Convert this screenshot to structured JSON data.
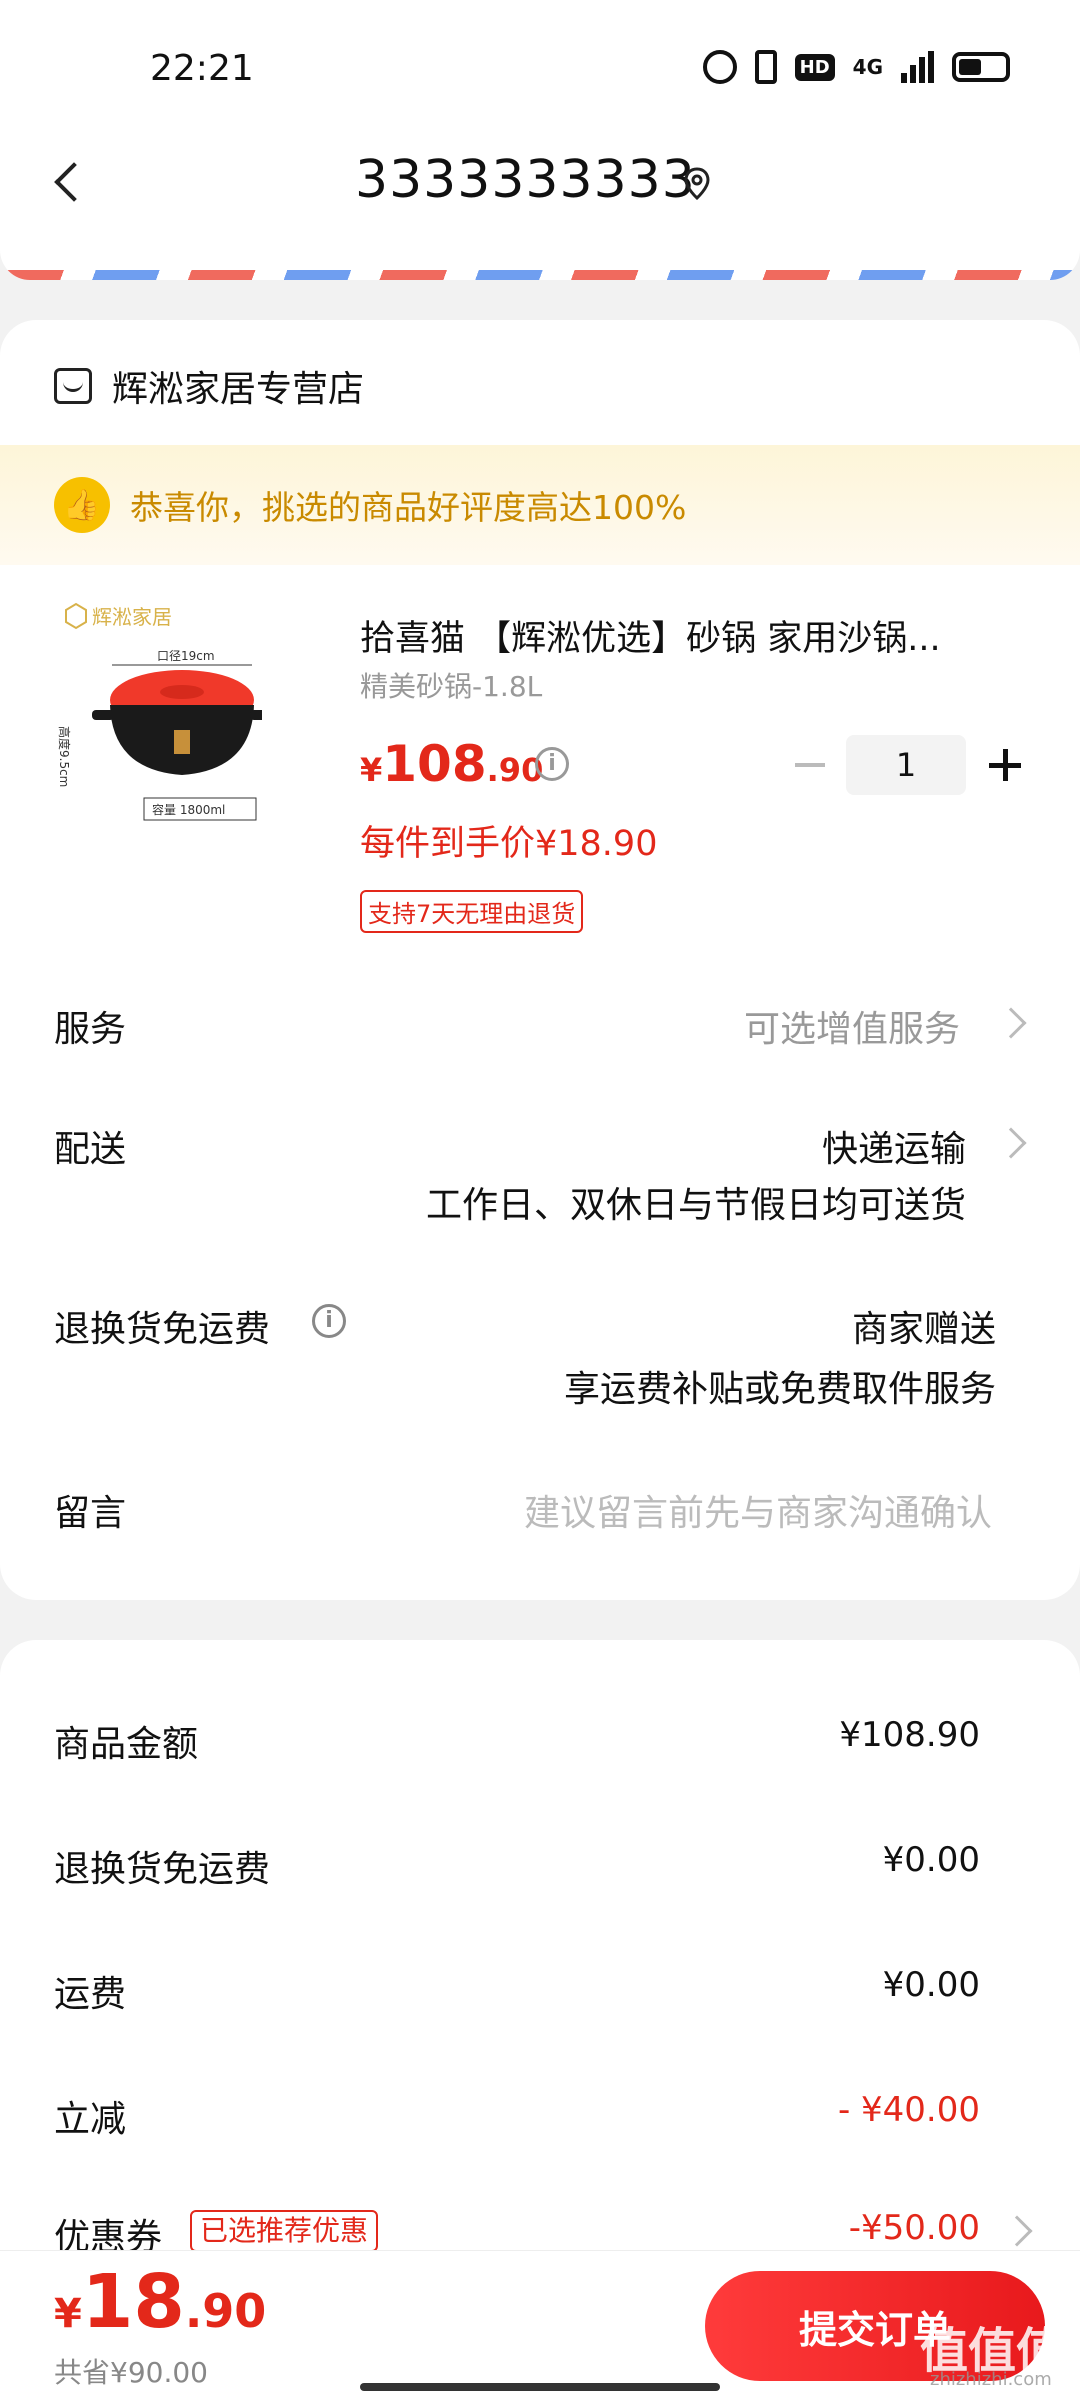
{
  "status_bar": {
    "time": "22:21",
    "hd": "HD",
    "network": "4G"
  },
  "header": {
    "phone": "3333333333",
    "back_icon": "chevron-left-icon",
    "location_icon": "location-pin-icon"
  },
  "shop": {
    "name": "辉淞家居专营店",
    "icon": "store-icon"
  },
  "praise": {
    "text": "恭喜你，挑选的商品好评度高达100%",
    "icon": "thumbs-up-icon"
  },
  "product": {
    "image_brand": "辉淞家居",
    "image_dim_top": "口径19cm",
    "image_dim_side": "高度9.5cm",
    "image_capacity": "容量 1800ml",
    "title": "拾喜猫 【辉淞优选】砂锅 家用沙锅...",
    "spec": "精美砂锅-1.8L",
    "price_currency": "¥",
    "price_int": "108",
    "price_dec": ".90",
    "quantity": "1",
    "unit_price": "每件到手价¥18.90",
    "return_badge": "支持7天无理由退货"
  },
  "rows": {
    "service_label": "服务",
    "service_value": "可选增值服务",
    "delivery_label": "配送",
    "delivery_value": "快递运输",
    "delivery_note": "工作日、双休日与节假日均可送货",
    "return_label": "退换货免运费",
    "return_value": "商家赠送",
    "return_note": "享运费补贴或免费取件服务",
    "message_label": "留言",
    "message_placeholder": "建议留言前先与商家沟通确认"
  },
  "summary": {
    "goods_label": "商品金额",
    "goods_value": "¥108.90",
    "return_label": "退换货免运费",
    "return_value": "¥0.00",
    "shipping_label": "运费",
    "shipping_value": "¥0.00",
    "discount_label": "立减",
    "discount_value": "- ¥40.00",
    "coupon_label": "优惠券",
    "coupon_tag": "已选推荐优惠",
    "coupon_value": "-¥50.00"
  },
  "footer": {
    "total_currency": "¥",
    "total_int": "18",
    "total_dec": ".90",
    "saved": "共省¥90.00",
    "submit_label": "提交订单",
    "watermark": "值值值",
    "watermark_sub": "zhizhizhi.com"
  },
  "colors": {
    "accent_red": "#e3281a",
    "praise_gold": "#c98a00"
  }
}
